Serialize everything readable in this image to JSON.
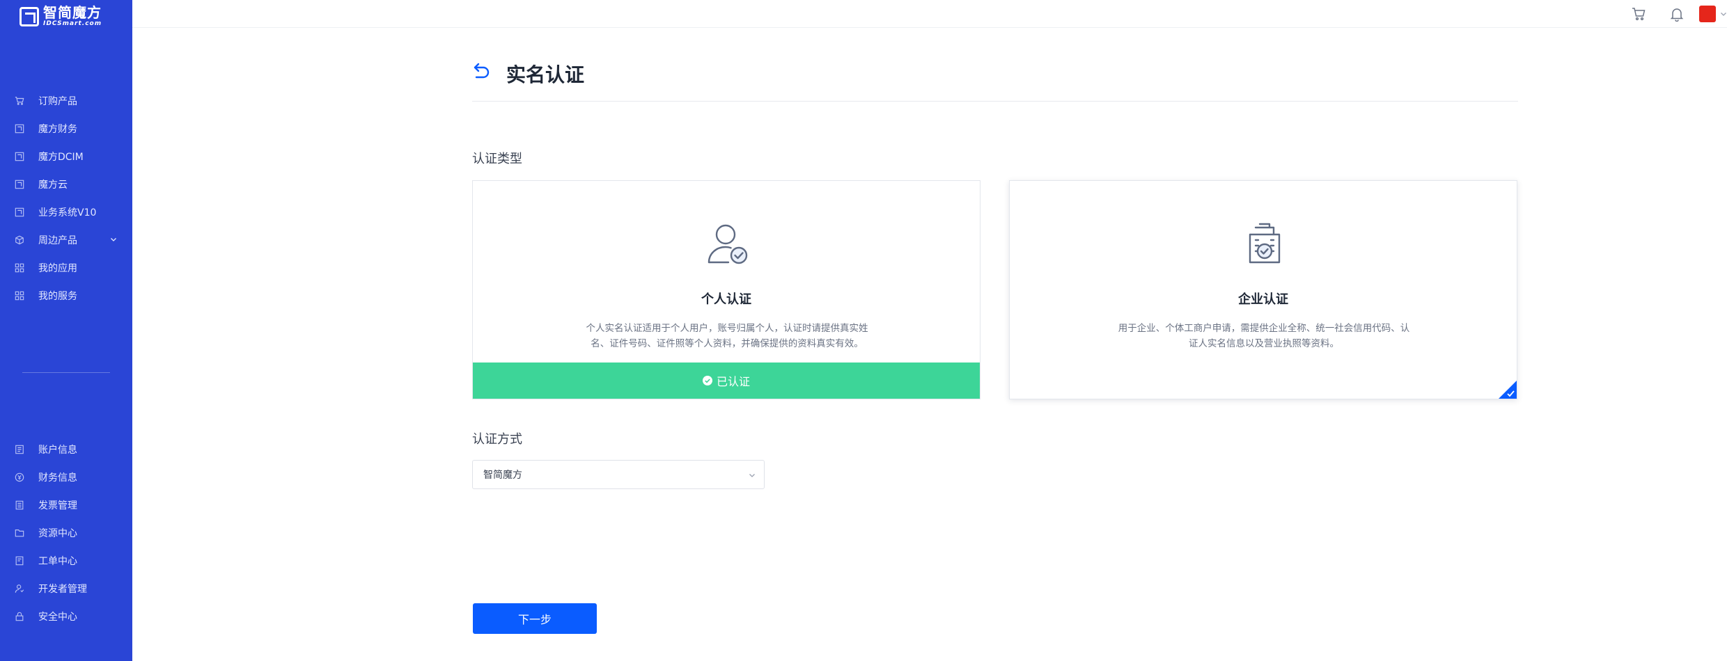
{
  "brand": {
    "name_cn": "智简魔方",
    "name_en": "IDCSmart.com"
  },
  "sidebar": {
    "top_items": [
      {
        "label": "订购产品",
        "icon": "cart-icon"
      },
      {
        "label": "魔方财务",
        "icon": "brand-square-icon"
      },
      {
        "label": "魔方DCIM",
        "icon": "brand-square-icon"
      },
      {
        "label": "魔方云",
        "icon": "brand-square-icon"
      },
      {
        "label": "业务系统V10",
        "icon": "brand-square-icon"
      },
      {
        "label": "周边产品",
        "icon": "cube-icon",
        "expandable": true
      },
      {
        "label": "我的应用",
        "icon": "grid-icon"
      },
      {
        "label": "我的服务",
        "icon": "grid-icon"
      }
    ],
    "bottom_items": [
      {
        "label": "账户信息",
        "icon": "id-card-icon"
      },
      {
        "label": "财务信息",
        "icon": "coin-icon"
      },
      {
        "label": "发票管理",
        "icon": "invoice-icon"
      },
      {
        "label": "资源中心",
        "icon": "folder-icon"
      },
      {
        "label": "工单中心",
        "icon": "ticket-icon"
      },
      {
        "label": "开发者管理",
        "icon": "developer-icon"
      },
      {
        "label": "安全中心",
        "icon": "lock-icon"
      }
    ]
  },
  "header": {
    "icons": [
      "cart-icon",
      "bell-icon",
      "avatar"
    ]
  },
  "page": {
    "title": "实名认证",
    "type_label": "认证类型",
    "method_label": "认证方式",
    "next_label": "下一步"
  },
  "cards": {
    "personal": {
      "title": "个人认证",
      "desc": "个人实名认证适用于个人用户，账号归属个人，认证时请提供真实姓名、证件号码、证件照等个人资料，并确保提供的资料真实有效。",
      "status": "已认证"
    },
    "company": {
      "title": "企业认证",
      "desc": "用于企业、个体工商户申请，需提供企业全称、统一社会信用代码、认证人实名信息以及营业执照等资料。",
      "selected": true
    }
  },
  "method_select": {
    "value": "智简魔方"
  },
  "colors": {
    "sidebar_bg": "#2a45d6",
    "primary": "#0a5cff",
    "verified_green": "#3dd598",
    "avatar_red": "#e5261b"
  }
}
